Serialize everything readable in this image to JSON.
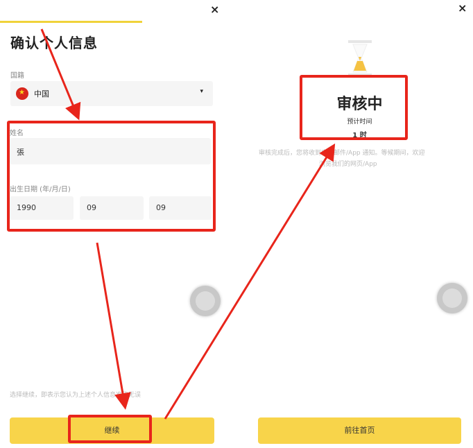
{
  "left": {
    "close_icon": "×",
    "title": "确认个人信息",
    "nationality_label": "国籍",
    "nationality_value": "中国",
    "caret": "▾",
    "name_label": "姓名",
    "name_value": "張",
    "dob_label": "出生日期 (年/月/日)",
    "dob_year": "1990",
    "dob_month": "09",
    "dob_day": "09",
    "disclaimer": "选择继续，即表示您认为上述个人信息准确无误",
    "continue_button": "继续"
  },
  "right": {
    "close_icon": "×",
    "status_title": "审核中",
    "eta_label": "预计时间",
    "eta_value": "1 时",
    "description_line1": "审核完成后，您将收到电子邮件/App 通知。等候期间，欢迎",
    "description_line2": "浏览我们的网页/App",
    "home_button": "前往首页"
  },
  "colors": {
    "accent_yellow": "#f8d44a",
    "annotation_red": "#e8251b",
    "flag_red": "#d9261c"
  }
}
